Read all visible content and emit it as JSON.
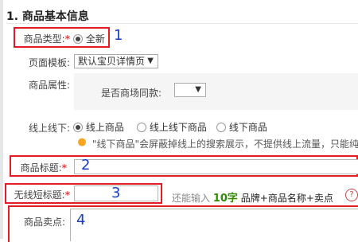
{
  "section": {
    "title": "1. 商品基本信息"
  },
  "product_type": {
    "label": "商品类型:",
    "required_mark": "*",
    "option": "全新",
    "annotation": "1"
  },
  "page_template": {
    "label": "页面模板:",
    "value": "默认宝贝详情页",
    "caret": "▼"
  },
  "product_attr": {
    "label": "商品属性:",
    "field_label": "是否商场同款:",
    "caret": "▼"
  },
  "online_offline": {
    "label": "线上线下:",
    "options": [
      "线上商品",
      "线上线下商品",
      "线下商品"
    ],
    "selected_index": 0,
    "tip": "\"线下商品\"会屏蔽掉线上的搜索展示，不提供线上流量，只能纯线"
  },
  "product_title": {
    "label": "商品标题:",
    "required_mark": "*",
    "annotation": "2"
  },
  "wireless_title": {
    "label": "无线短标题:",
    "required_mark": "*",
    "annotation": "3",
    "hint_prefix": "还能输入",
    "hint_count": "10字",
    "hint_suffix": "品牌+商品名称+卖点",
    "help": "?"
  },
  "selling_point": {
    "label": "商品卖点:",
    "annotation": "4"
  },
  "colors": {
    "red_outline": "#e31b23",
    "annotation_blue": "#1a3dc8",
    "required_red": "#e4393c",
    "count_green": "#2e8b00",
    "panel_gray": "#f5f5f5"
  }
}
